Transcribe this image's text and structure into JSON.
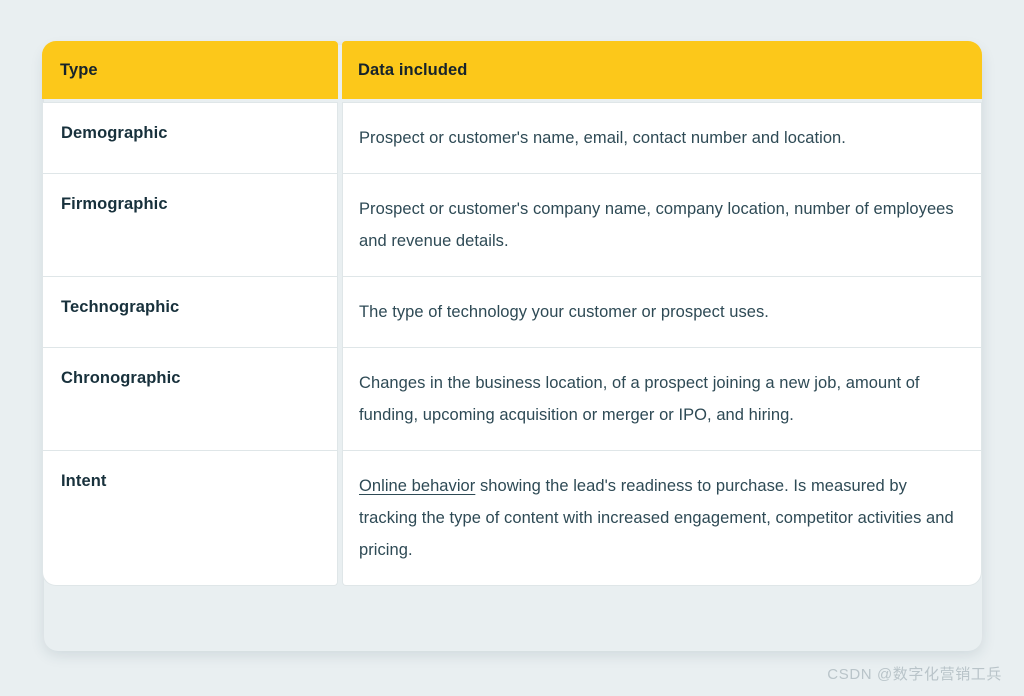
{
  "background_color": "#e9eff1",
  "accent_color": "#fcc81a",
  "heading_text_color": "#16232b",
  "body_text_color": "#2e4a55",
  "table": {
    "headers": {
      "type": "Type",
      "data": "Data included"
    },
    "rows": [
      {
        "type": "Demographic",
        "data": "Prospect or customer's name, email, contact number and location."
      },
      {
        "type": "Firmographic",
        "data": "Prospect or customer's company name, company location, number of employees and revenue details."
      },
      {
        "type": "Technographic",
        "data": "The type of technology your customer or prospect uses."
      },
      {
        "type": "Chronographic",
        "data": "Changes in the business location, of a prospect joining a new job, amount of funding, upcoming acquisition or merger or IPO, and hiring."
      },
      {
        "type": "Intent",
        "data_link": "Online behavior",
        "data_rest": " showing the lead's readiness to purchase. Is measured by tracking the type of content with increased engagement, competitor activities and pricing."
      }
    ]
  },
  "watermark": {
    "text": "CSDN @数字化营销工兵"
  }
}
